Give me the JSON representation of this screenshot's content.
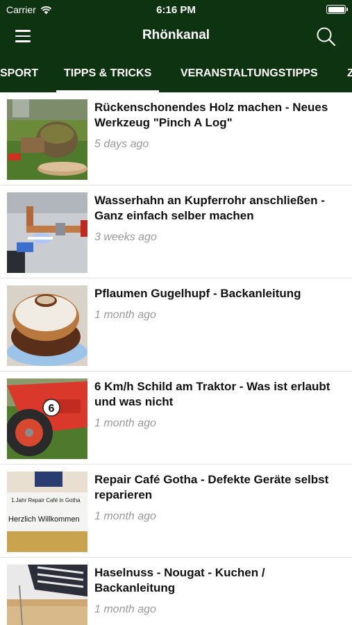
{
  "status": {
    "carrier": "Carrier",
    "time": "6:16 PM",
    "battery_level": 1.0
  },
  "navbar": {
    "title": "Rhönkanal",
    "menu_icon": "hamburger-menu-icon",
    "search_icon": "search-icon"
  },
  "tabs": [
    {
      "label": "SPORT",
      "selected": false
    },
    {
      "label": "TIPPS & TRICKS",
      "selected": true
    },
    {
      "label": "VERANSTALTUNGSTIPPS",
      "selected": false
    },
    {
      "label": "Z",
      "selected": false
    }
  ],
  "articles": [
    {
      "title": "Rückenschonendes Holz machen - Neues Werkzeug \"Pinch A Log\"",
      "ago": "5 days ago"
    },
    {
      "title": "Wasserhahn an Kupferrohr anschließen - Ganz einfach selber machen",
      "ago": "3 weeks ago"
    },
    {
      "title": "Pflaumen Gugelhupf  - Backanleitung",
      "ago": "1 month ago"
    },
    {
      "title": "6 Km/h Schild am Traktor - Was ist erlaubt und was nicht",
      "ago": "1 month ago"
    },
    {
      "title": "Repair Café Gotha - Defekte Geräte selbst reparieren",
      "ago": "1 month ago"
    },
    {
      "title": "Haselnuss - Nougat - Kuchen / Backanleitung",
      "ago": "1 month ago"
    }
  ],
  "thumbnail_texts": {
    "speed_sign": "6",
    "banner_line1": "1.Jahr Repair Café in Gotha",
    "banner_line2": "Herzlich Willkommen"
  },
  "colors": {
    "header_bg": "#0d3310",
    "title_text": "#111111",
    "meta_text": "#9a9a9a"
  }
}
